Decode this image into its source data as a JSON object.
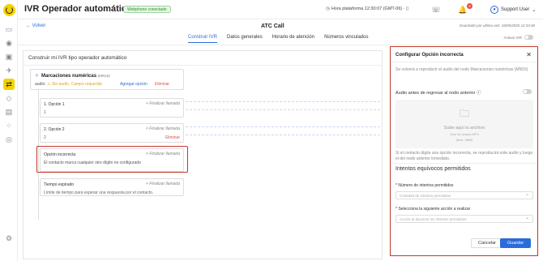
{
  "app": {
    "title": "IVR Operador automático",
    "status_badge": "Webphone conectado"
  },
  "topbar": {
    "clock": "Hora plataforma 12:30:07 (GMT-06) · ▯",
    "notifications_count": "6",
    "user": "Support User"
  },
  "header": {
    "back": "Volver",
    "call_title": "ATC Call",
    "saved": "Guardado por ultima vez: 18/05/2025 12:34:48",
    "ivr_toggle_label": "Activar IVR",
    "tabs": [
      "Construir IVR",
      "Datos generales",
      "Horario de atención",
      "Números vinculados"
    ]
  },
  "builder": {
    "title": "Construir mi IVR tipo operador automático",
    "node": {
      "title": "Marcaciones numéricas",
      "tag": "(MN16)",
      "audio_label": "audio:",
      "audio_warning": "⚠ Sin audio, Campo requerido",
      "add_option": "Agregar opción",
      "delete": "Eliminar"
    },
    "cards": [
      {
        "title": "1. Opción 1",
        "sub": "1",
        "finish": "Finalizar llamada",
        "delete": ""
      },
      {
        "title": "2. Opción 2",
        "sub": "2",
        "finish": "Finalizar llamada",
        "delete": "Eliminar"
      },
      {
        "title": "Opción incorrecta",
        "sub": "El contacto marca cualquier otro dígito no configurado",
        "finish": "Finalizar llamada",
        "delete": ""
      },
      {
        "title": "Tiempo expirado",
        "sub": "Límite de tiempo para esperar una respuesta por el contacto.",
        "finish": "Finalizar llamada",
        "delete": ""
      }
    ]
  },
  "panel": {
    "title": "Configurar Opción incorrecta",
    "description": "Se volverá a reproducir el audio del nodo Marcaciones numéricas (MN16)",
    "audio_before_label": "Audio antes de regresar al nodo anterior",
    "upload": {
      "main": "Sube aquí tu archivo",
      "formats": "Solo se acepta MP3",
      "max": "(Max. 5MB)"
    },
    "note": "Si el contacto digita una opción incorrecta, se reproducirá este audio y luego el del nodo anterior inmediato.",
    "section": "Intentos equivocos permitidos",
    "field1": {
      "label": "* Número de intentos permitidos",
      "placeholder": "Cantidad de intentos permitidos"
    },
    "field2": {
      "label": "* Selecciona la siguiente acción a realizar",
      "placeholder": "Acción al alcanzar los intentos permitidos"
    },
    "cancel": "Cancelar",
    "save": "Guardar"
  }
}
